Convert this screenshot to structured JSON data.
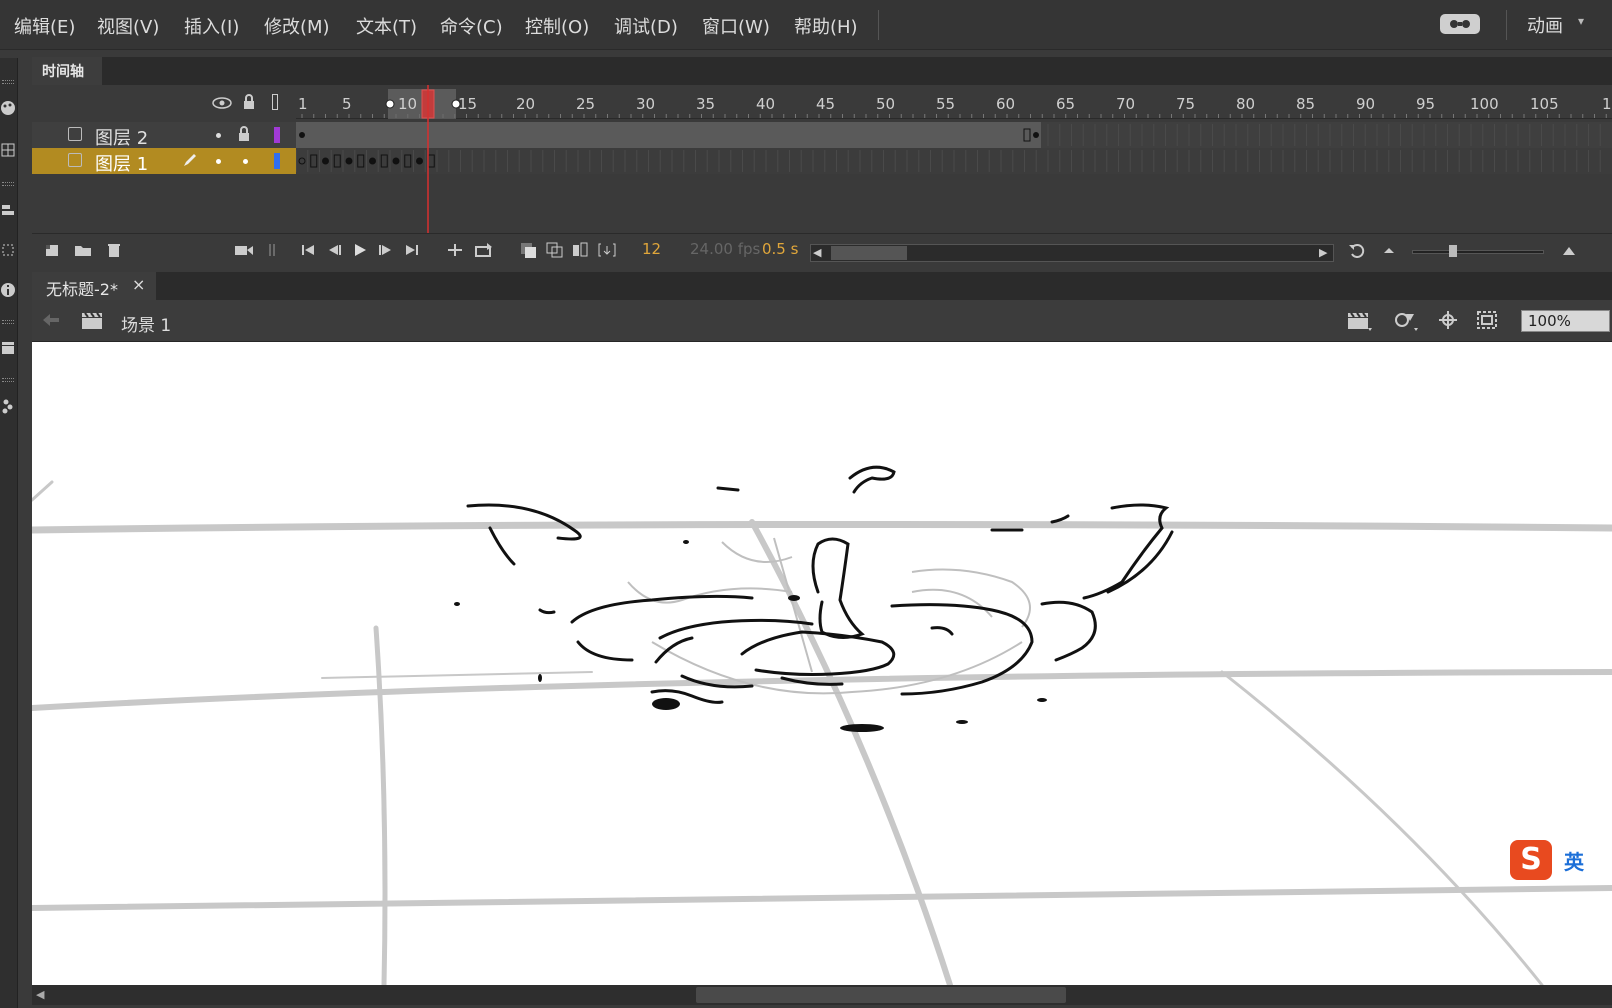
{
  "menubar": {
    "items": [
      "编辑(E)",
      "视图(V)",
      "插入(I)",
      "修改(M)",
      "文本(T)",
      "命令(C)",
      "控制(O)",
      "调试(D)",
      "窗口(W)",
      "帮助(H)"
    ],
    "workspace_label": "动画",
    "workspace_arrow": "▾"
  },
  "timeline": {
    "tab_label": "时间轴",
    "ruler_numbers": [
      "1",
      "5",
      "10",
      "15",
      "20",
      "25",
      "30",
      "35",
      "40",
      "45",
      "50",
      "55",
      "60",
      "65",
      "70",
      "75",
      "80",
      "85",
      "90",
      "95",
      "100",
      "105",
      "1"
    ],
    "layers": [
      {
        "name": "图层 2",
        "color": "#a13ad6"
      },
      {
        "name": "图层 1",
        "color": "#2f6ef0"
      }
    ],
    "current_frame": "12",
    "fps": "24.00 fps",
    "elapsed": "0.5 s"
  },
  "document": {
    "tab_label": "无标题-2*",
    "close_glyph": "×",
    "scene_label": "场景 1",
    "zoom": "100%"
  },
  "ime": {
    "logo": "S",
    "label": "英"
  },
  "colors": {
    "accent_layer_selected": "#b28b21",
    "playhead": "#d83030",
    "stage_bg": "#ffffff"
  }
}
